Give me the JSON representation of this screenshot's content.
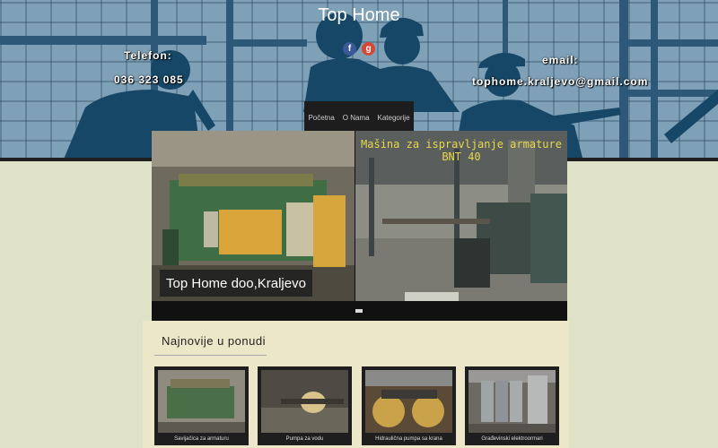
{
  "header": {
    "title": "Top Home",
    "phone_label": "Telefon:",
    "phone": "036 323 085",
    "email_label": "email:",
    "email": "tophome.kraljevo@gmail.com",
    "social": [
      {
        "name": "facebook-icon",
        "glyph": "f",
        "color": "#3b5998"
      },
      {
        "name": "google-plus-icon",
        "glyph": "g",
        "color": "#d34836"
      }
    ]
  },
  "nav": {
    "items": [
      "Početna",
      "O Nama",
      "Kategorije"
    ]
  },
  "slider": {
    "caption": "Top Home doo,Kraljevo",
    "overlay_line1": "Mašina za ispravljanje armature",
    "overlay_line2": "BNT 40"
  },
  "section": {
    "title": "Najnovije u ponudi"
  },
  "products": [
    {
      "caption": "Savijačica za armaturu"
    },
    {
      "caption": "Pumpa za vodu"
    },
    {
      "caption": "Hidraulična pumpa sa krana"
    },
    {
      "caption": "Građevinski elektroormari"
    }
  ]
}
